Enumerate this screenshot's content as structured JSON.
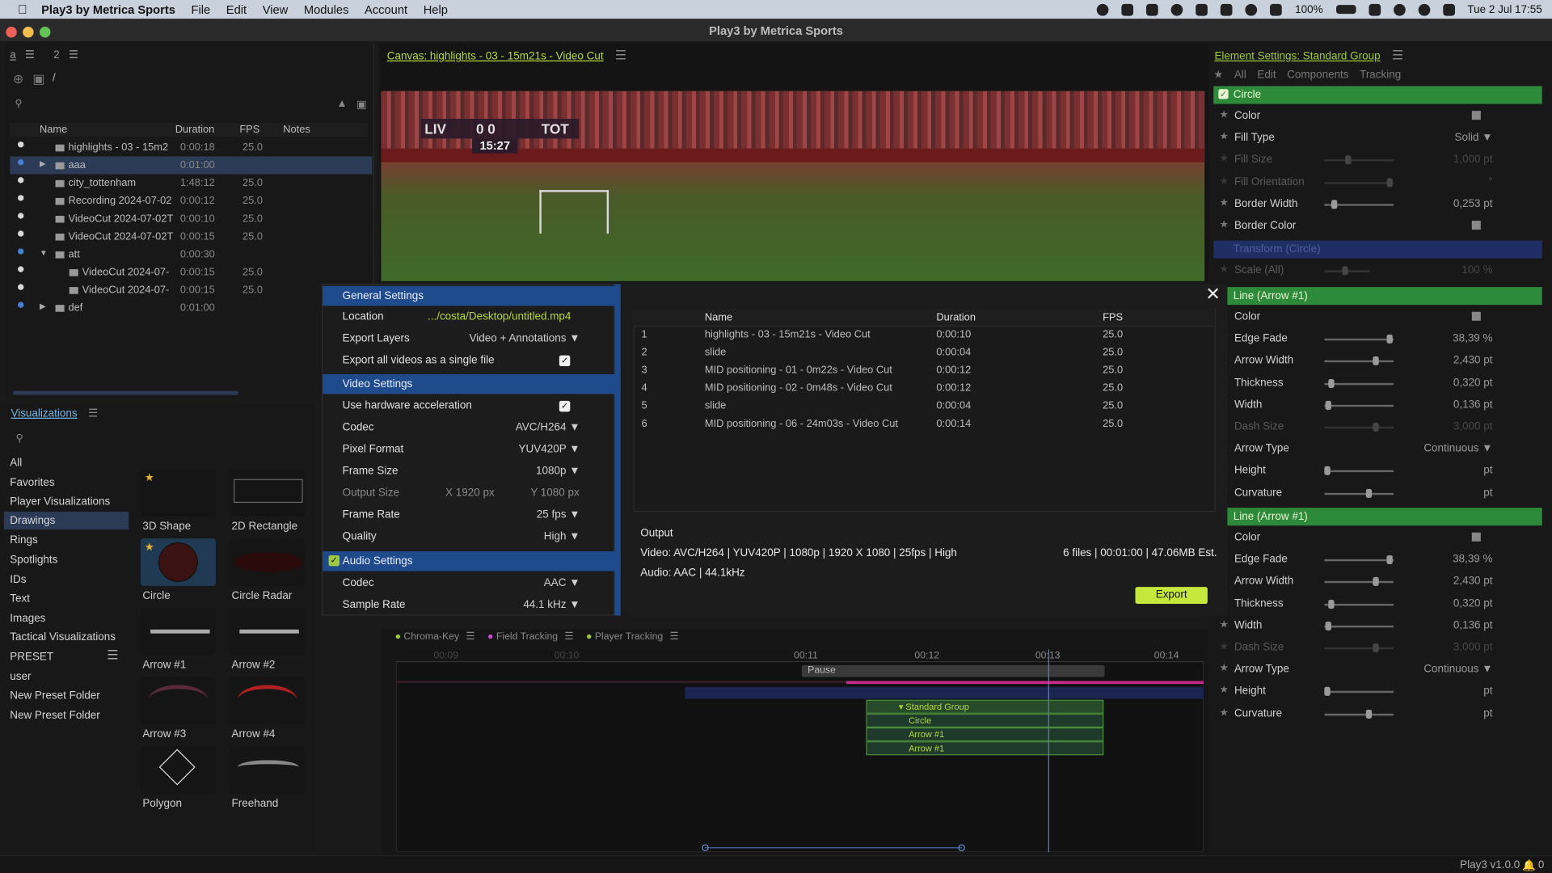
{
  "menubar": {
    "app": "Play3 by Metrica Sports",
    "items": [
      "File",
      "Edit",
      "View",
      "Modules",
      "Account",
      "Help"
    ],
    "battery": "100%",
    "datetime": "Tue 2 Jul  17:55"
  },
  "window": {
    "title": "Play3 by Metrica Sports"
  },
  "library": {
    "tab_a": "a",
    "tab_2": "2",
    "path": "/",
    "columns": [
      "Name",
      "Duration",
      "FPS",
      "Notes"
    ],
    "rows": [
      {
        "name": "highlights - 03 - 15m2",
        "duration": "0:00:18",
        "fps": "25.0",
        "type": "video",
        "indent": 0,
        "dot": "#d8d8d8"
      },
      {
        "name": "aaa",
        "duration": "0:01:00",
        "fps": "",
        "type": "folder",
        "indent": 0,
        "dot": "#4a7fd0",
        "selected": true,
        "collapsed": true
      },
      {
        "name": "city_tottenham",
        "duration": "1:48:12",
        "fps": "25.0",
        "type": "video",
        "indent": 0,
        "dot": "#d8d8d8"
      },
      {
        "name": "Recording 2024-07-02",
        "duration": "0:00:12",
        "fps": "25.0",
        "type": "video",
        "indent": 0,
        "dot": "#d8d8d8"
      },
      {
        "name": "VideoCut 2024-07-02T",
        "duration": "0:00:10",
        "fps": "25.0",
        "type": "video",
        "indent": 0,
        "dot": "#d8d8d8"
      },
      {
        "name": "VideoCut 2024-07-02T",
        "duration": "0:00:15",
        "fps": "25.0",
        "type": "video",
        "indent": 0,
        "dot": "#d8d8d8"
      },
      {
        "name": "att",
        "duration": "0:00:30",
        "fps": "",
        "type": "folder",
        "indent": 0,
        "dot": "#4a7fd0",
        "expanded": true
      },
      {
        "name": "VideoCut 2024-07-",
        "duration": "0:00:15",
        "fps": "25.0",
        "type": "video",
        "indent": 1,
        "dot": "#d8d8d8"
      },
      {
        "name": "VideoCut 2024-07-",
        "duration": "0:00:15",
        "fps": "25.0",
        "type": "video",
        "indent": 1,
        "dot": "#d8d8d8"
      },
      {
        "name": "def",
        "duration": "0:01:00",
        "fps": "",
        "type": "folder",
        "indent": 0,
        "dot": "#4a7fd0",
        "collapsed": true
      }
    ]
  },
  "visualizations": {
    "title": "Visualizations",
    "categories": [
      "All",
      "Favorites",
      "Player Visualizations",
      "Drawings",
      "Rings",
      "Spotlights",
      "IDs",
      "Text",
      "Images",
      "Tactical Visualizations",
      "PRESET",
      "user",
      "New Preset Folder",
      "New Preset Folder"
    ],
    "selected_category": "Drawings",
    "items": [
      "3D Shape",
      "2D Rectangle",
      "Circle",
      "Circle Radar",
      "Arrow #1",
      "Arrow #2",
      "Arrow #3",
      "Arrow #4",
      "Polygon",
      "Freehand"
    ]
  },
  "canvas": {
    "title": "Canvas: highlights - 03 - 15m21s - Video Cut",
    "score_home": "LIV",
    "score": "0 0",
    "score_away": "TOT",
    "clock": "15:27"
  },
  "export": {
    "general": {
      "title": "General Settings",
      "location_label": "Location",
      "location_value": ".../costa/Desktop/untitled.mp4",
      "layers_label": "Export Layers",
      "layers_value": "Video + Annotations ▼",
      "single_label": "Export all videos as a single file"
    },
    "video": {
      "title": "Video Settings",
      "hw_label": "Use hardware acceleration",
      "codec_label": "Codec",
      "codec_value": "AVC/H264 ▼",
      "pixfmt_label": "Pixel Format",
      "pixfmt_value": "YUV420P ▼",
      "framesize_label": "Frame Size",
      "framesize_value": "1080p ▼",
      "outsize_label": "Output Size",
      "outsize_x": "X  1920 px",
      "outsize_y": "Y  1080 px",
      "framerate_label": "Frame Rate",
      "framerate_value": "25 fps ▼",
      "quality_label": "Quality",
      "quality_value": "High ▼"
    },
    "audio": {
      "title": "Audio Settings",
      "codec_label": "Codec",
      "codec_value": "AAC ▼",
      "rate_label": "Sample Rate",
      "rate_value": "44.1 kHz ▼"
    },
    "table": {
      "columns": [
        "Name",
        "Duration",
        "FPS"
      ],
      "rows": [
        {
          "n": "1",
          "name": "highlights - 03 - 15m21s - Video Cut",
          "duration": "0:00:10",
          "fps": "25.0"
        },
        {
          "n": "2",
          "name": "slide",
          "duration": "0:00:04",
          "fps": "25.0"
        },
        {
          "n": "3",
          "name": "MID positioning - 01 - 0m22s - Video Cut",
          "duration": "0:00:12",
          "fps": "25.0"
        },
        {
          "n": "4",
          "name": "MID positioning - 02 - 0m48s - Video Cut",
          "duration": "0:00:12",
          "fps": "25.0"
        },
        {
          "n": "5",
          "name": "slide",
          "duration": "0:00:04",
          "fps": "25.0"
        },
        {
          "n": "6",
          "name": "MID positioning - 06 - 24m03s - Video Cut",
          "duration": "0:00:14",
          "fps": "25.0"
        }
      ]
    },
    "output": {
      "title": "Output",
      "video": "Video: AVC/H264 | YUV420P | 1080p | 1920 X 1080 | 25fps | High",
      "audio": "Audio: AAC | 44.1kHz",
      "summary": "6 files | 00:01:00 | 47.06MB Est.",
      "export_label": "Export"
    }
  },
  "settings": {
    "title": "Element Settings: Standard Group",
    "tabs": [
      "All",
      "Edit",
      "Components",
      "Tracking"
    ],
    "circle_label": "Circle",
    "circle_props": [
      {
        "name": "Color",
        "value": "",
        "slider": null
      },
      {
        "name": "Fill Type",
        "value": "Solid ▼",
        "slider": null
      },
      {
        "name": "Fill Size",
        "value": "1,000 pt",
        "slider": 0.3,
        "dim": true
      },
      {
        "name": "Fill Orientation",
        "value": "°",
        "slider": 0.9,
        "dim": true
      },
      {
        "name": "Border Width",
        "value": "0,253 pt",
        "slider": 0.1
      },
      {
        "name": "Border Color",
        "value": "",
        "slider": null
      }
    ],
    "transform_label": "Transform (Circle)",
    "scale_label": "Scale (All)",
    "scale_value": "100 %",
    "line1_label": "Line (Arrow #1)",
    "line2_label": "Line (Arrow #1)",
    "line_props": [
      {
        "name": "Color",
        "value": "",
        "slider": null
      },
      {
        "name": "Edge Fade",
        "value": "38,39 %",
        "slider": 0.9
      },
      {
        "name": "Arrow Width",
        "value": "2,430 pt",
        "slider": 0.7
      },
      {
        "name": "Thickness",
        "value": "0,320 pt",
        "slider": 0.05
      },
      {
        "name": "Width",
        "value": "0,136 pt",
        "slider": 0.02
      },
      {
        "name": "Dash Size",
        "value": "3,000 pt",
        "slider": 0.7,
        "dim": true
      },
      {
        "name": "Arrow Type",
        "value": "Continuous ▼",
        "slider": null
      },
      {
        "name": "Height",
        "value": "pt",
        "slider": 0.0
      },
      {
        "name": "Curvature",
        "value": "pt",
        "slider": 0.6
      }
    ]
  },
  "timeline": {
    "tabs": [
      "Chroma-Key",
      "Field Tracking",
      "Player Tracking"
    ],
    "ticks": [
      "00:09",
      "00:10",
      "00:11",
      "00:12",
      "00:13",
      "00:14"
    ],
    "pause_label": "Pause",
    "group_label": "▾ Standard Group",
    "clips": [
      "Circle",
      "Arrow #1",
      "Arrow #1"
    ]
  },
  "status": {
    "version": "Play3 v1.0.0",
    "notif": "0"
  }
}
